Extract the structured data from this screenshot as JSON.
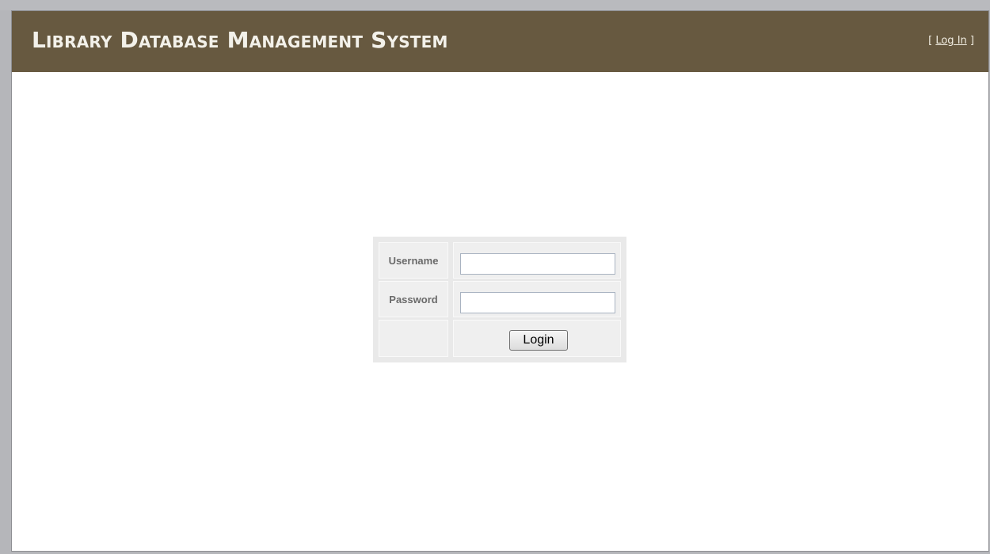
{
  "header": {
    "title": "Library Database Management System",
    "login_prefix": "[ ",
    "login_link": "Log In",
    "login_suffix": " ]"
  },
  "login_form": {
    "username_label": "Username",
    "username_value": "",
    "password_label": "Password",
    "password_value": "",
    "submit_label": "Login"
  },
  "colors": {
    "header_bg": "#675940",
    "header_text": "#f3f1ea",
    "panel_bg": "#efefef",
    "frame": "#b5b6ba"
  }
}
